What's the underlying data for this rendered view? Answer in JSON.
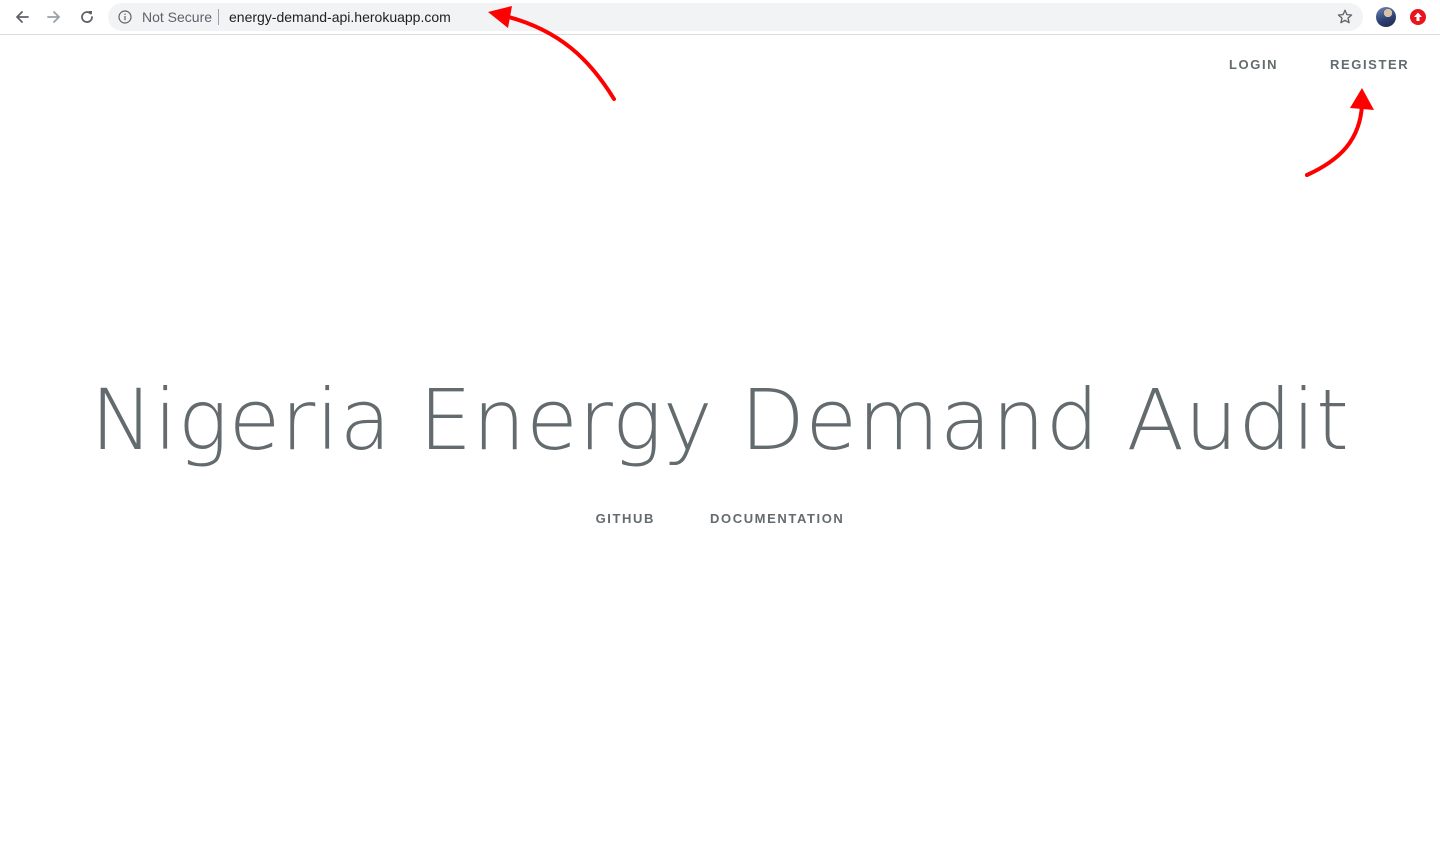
{
  "browser": {
    "security_label": "Not Secure",
    "url": "energy-demand-api.herokuapp.com"
  },
  "top_nav": {
    "login_label": "LOGIN",
    "register_label": "REGISTER"
  },
  "hero": {
    "title": "Nigeria Energy Demand Audit",
    "links": {
      "github_label": "GITHUB",
      "documentation_label": "DOCUMENTATION"
    }
  },
  "colors": {
    "text": "#636b6f",
    "annotation_arrow": "#ff0000",
    "omnibox_bg": "#f1f3f4"
  },
  "icons": {
    "back": "back-arrow-icon",
    "forward": "forward-arrow-icon",
    "reload": "reload-icon",
    "info": "info-icon",
    "bookmark": "star-icon",
    "profile": "avatar",
    "extension": "extension-icon"
  }
}
